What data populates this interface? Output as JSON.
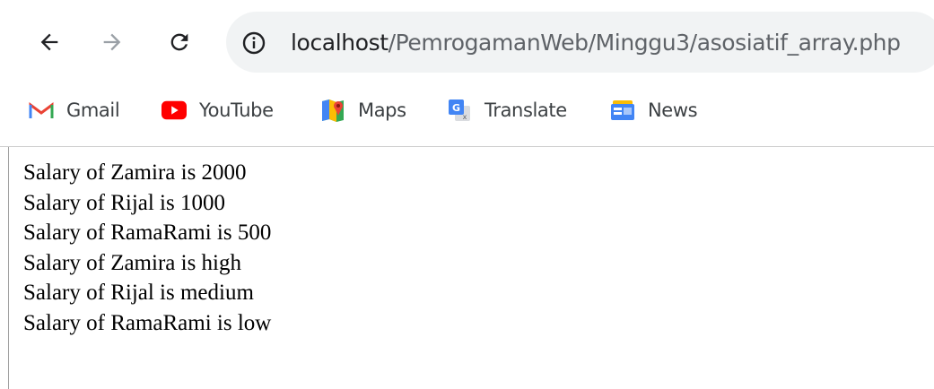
{
  "address_bar": {
    "host": "localhost",
    "path": "/PemrogamanWeb/Minggu3/asosiatif_array.php"
  },
  "bookmarks": [
    {
      "label": "Gmail",
      "icon": "gmail-icon"
    },
    {
      "label": "YouTube",
      "icon": "youtube-icon"
    },
    {
      "label": "Maps",
      "icon": "maps-icon"
    },
    {
      "label": "Translate",
      "icon": "translate-icon"
    },
    {
      "label": "News",
      "icon": "news-icon"
    }
  ],
  "page": {
    "lines": [
      "Salary of Zamira is 2000",
      "Salary of Rijal is 1000",
      "Salary of RamaRami is 500",
      "Salary of Zamira is high",
      "Salary of Rijal is medium",
      "Salary of RamaRami is low"
    ]
  },
  "colors": {
    "omnibox_bg": "#f1f3f4",
    "host_text": "#202124",
    "path_text": "#5f6368",
    "youtube_red": "#ff0000",
    "gmail_red": "#ea4335"
  }
}
